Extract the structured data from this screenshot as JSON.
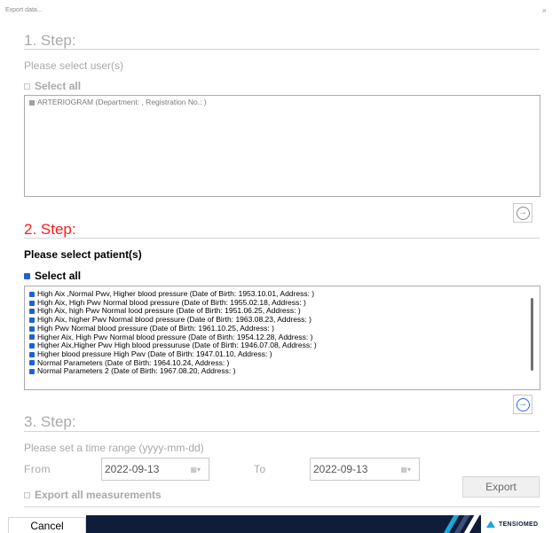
{
  "window": {
    "title": "Export data...",
    "close_glyph": "×"
  },
  "step1": {
    "title": "1. Step:",
    "prompt": "Please select user(s)",
    "select_all": "Select all",
    "users": [
      {
        "label": "ARTERIOGRAM (Department: , Registration No.: )"
      }
    ],
    "next_icon": "arrow-right-circle-icon"
  },
  "step2": {
    "title": "2. Step:",
    "prompt": "Please select patient(s)",
    "select_all": "Select all",
    "patients": [
      {
        "label": "High Aix ,Normal Pwv, Higher blood pressure (Date of Birth: 1953.10.01, Address: )"
      },
      {
        "label": "High Aix, High Pwv Normal blood pressure (Date of Birth: 1955.02.18, Address: )"
      },
      {
        "label": "High Aix, high Pwv Normal lood pressure (Date of Birth: 1951.06.25, Address: )"
      },
      {
        "label": "High Aix, higher Pwv Normal blood pressure (Date of Birth: 1963.08.23, Address: )"
      },
      {
        "label": "High Pwv Normal blood pressure (Date of Birth: 1961.10.25, Address: )"
      },
      {
        "label": "Higher Aix, High Pwv Normal blood pressure (Date of Birth: 1954.12.28, Address: )"
      },
      {
        "label": "Higher Aix,Higher Pwv High blood pressuruse (Date of Birth: 1946.07.08, Address: )"
      },
      {
        "label": "Higher blood pressure High Pwv (Date of Birth: 1947.01.10, Address: )"
      },
      {
        "label": "Normal Parameters (Date of Birth: 1964.10.24, Address: )"
      },
      {
        "label": "Normal Parameters 2 (Date of Birth: 1967.08.20, Address: )"
      }
    ],
    "next_icon": "arrow-right-circle-icon"
  },
  "step3": {
    "title": "3. Step:",
    "prompt": "Please set a time range (yyyy-mm-dd)",
    "from_label": "From",
    "from_value": "2022-09-13",
    "to_label": "To",
    "to_value": "2022-09-13",
    "export_all": "Export all measurements",
    "export_button": "Export"
  },
  "footer": {
    "cancel": "Cancel",
    "brand": "TENSIOMED"
  },
  "colors": {
    "step_active": "#ff1a1a",
    "step_inactive": "#a9a9a9",
    "checkbox_checked": "#1e62d0",
    "footer_band": "#0f1d3a"
  }
}
